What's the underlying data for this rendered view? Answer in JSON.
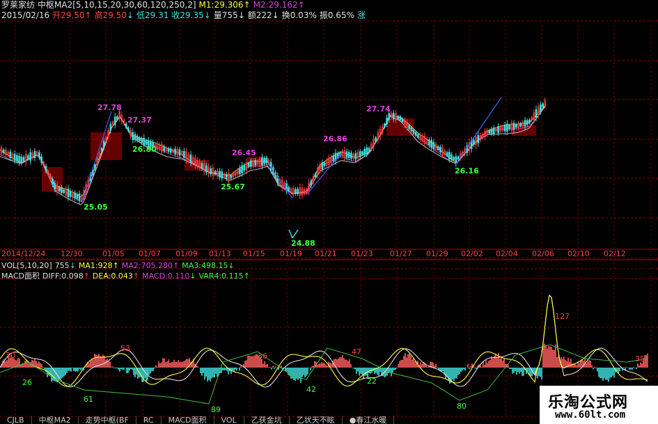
{
  "header": {
    "line1": {
      "stock": "罗莱家纺",
      "indicator": "中枢MA2[5,10,15,20,30,60,120,250,2]",
      "m1": "M1:29.306",
      "m1_arrow": "↑",
      "m2": "M2:29.162",
      "m2_arrow": "↑"
    },
    "line2": {
      "date": "2015/02/16",
      "open": "开29.50",
      "open_arrow": "↑",
      "high": "高29.50",
      "high_arrow": "↓",
      "low": "低29.31",
      "close": "收29.35",
      "close_arrow": "↓",
      "vol": "量755",
      "vol_arrow": "↓",
      "amount": "额222",
      "amount_arrow": "↓",
      "turnover": "换0.03%",
      "amplitude": "振0.65%",
      "change": "涨"
    }
  },
  "xaxis": {
    "labels": [
      "2014/12/24",
      "12/30",
      "01/05",
      "01/07",
      "01/09",
      "01/13",
      "01/15",
      "01/19",
      "01/21",
      "01/23",
      "01/27",
      "01/29",
      "02/02",
      "02/04",
      "02/06",
      "02/10",
      "02/12"
    ]
  },
  "price_labels": [
    {
      "text": "27.78",
      "color": "#e040e0"
    },
    {
      "text": "27.37",
      "color": "#e040e0"
    },
    {
      "text": "26.80",
      "color": "#40ff40"
    },
    {
      "text": "25.05",
      "color": "#40ff40"
    },
    {
      "text": "26.45",
      "color": "#e040e0"
    },
    {
      "text": "25.67",
      "color": "#40ff40"
    },
    {
      "text": "26.86",
      "color": "#e040e0"
    },
    {
      "text": "24.88",
      "color": "#40ff40"
    },
    {
      "text": "27.74",
      "color": "#e040e0"
    },
    {
      "text": "26.16",
      "color": "#40ff40"
    }
  ],
  "vol_line": {
    "label": "VOL[5,10,20]",
    "value": "755",
    "value_arrow": "↓",
    "ma1": "MA1:928",
    "ma1_arrow": "↑",
    "ma2": "MA2:705.280",
    "ma2_arrow": "↑",
    "ma3": "MA3:498.15",
    "ma3_arrow": "↓"
  },
  "macd_line": {
    "label": "MACD面积",
    "diff": "DIFF:0.098",
    "diff_arrow": "↑",
    "dea": "DEA:0.043",
    "dea_arrow": "↑",
    "macd": "MACD:0.110",
    "macd_arrow": "↓",
    "var4": "VAR4:0.115",
    "var4_arrow": "↑"
  },
  "macd_labels": [
    {
      "text": "30",
      "color": "#ff4040"
    },
    {
      "text": "26",
      "color": "#40ff40"
    },
    {
      "text": "53",
      "color": "#ff4040"
    },
    {
      "text": "61",
      "color": "#40ff40"
    },
    {
      "text": "89",
      "color": "#40ff40"
    },
    {
      "text": "36",
      "color": "#ff4040"
    },
    {
      "text": "42",
      "color": "#40ff40"
    },
    {
      "text": "47",
      "color": "#ff4040"
    },
    {
      "text": "22",
      "color": "#40ff40"
    },
    {
      "text": "80",
      "color": "#40ff40"
    },
    {
      "text": "127",
      "color": "#ff4040"
    },
    {
      "text": "35",
      "color": "#ff4040"
    }
  ],
  "watermark": {
    "title": "乐淘公式网",
    "url": "www.60lt.com"
  },
  "tabs": [
    "CJLB",
    "中枢MA2",
    "走势中枢(BF",
    "RC",
    "MACD面积",
    "VOL",
    "乙获金坑",
    "乙状天不眩",
    "●春江水暖"
  ],
  "colors": {
    "grid": "#8b0000",
    "text_red": "#ff4040",
    "text_cyan": "#40e0e0",
    "text_yellow": "#ffff40",
    "text_magenta": "#e040e0",
    "text_white": "#e0e0e0"
  }
}
